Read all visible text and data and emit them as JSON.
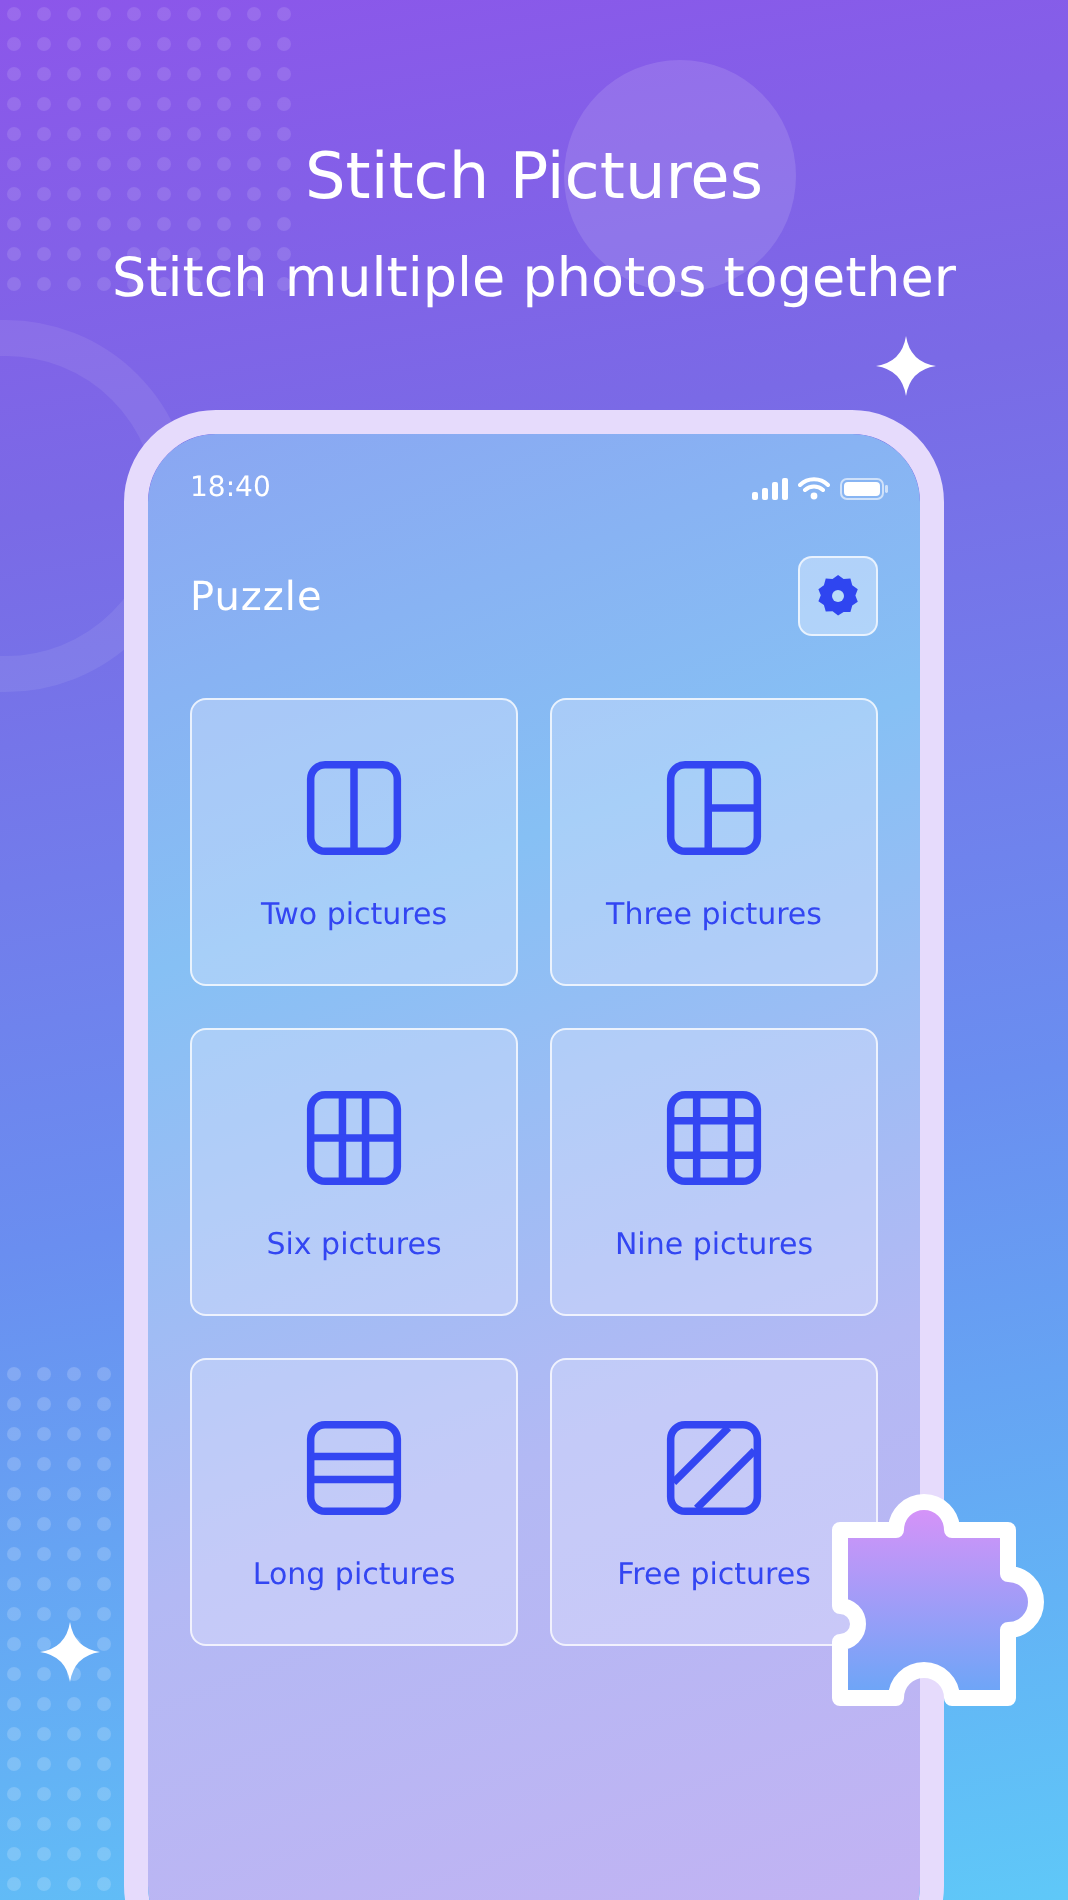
{
  "headline": "Stitch Pictures",
  "subheadline": "Stitch multiple photos together",
  "phone": {
    "status_bar": {
      "time": "18:40"
    },
    "title": "Puzzle",
    "options": [
      {
        "kind": "two",
        "label": "Two pictures"
      },
      {
        "kind": "three",
        "label": "Three pictures"
      },
      {
        "kind": "six",
        "label": "Six pictures"
      },
      {
        "kind": "nine",
        "label": "Nine pictures"
      },
      {
        "kind": "long",
        "label": "Long pictures"
      },
      {
        "kind": "free",
        "label": "Free pictures"
      }
    ]
  }
}
